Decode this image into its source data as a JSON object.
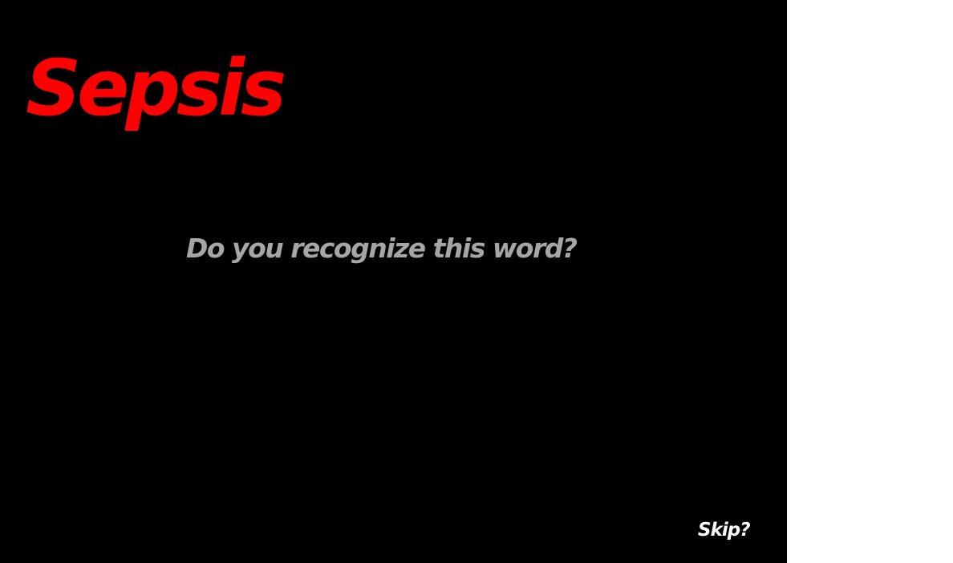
{
  "stimulus": {
    "word": "Sepsis",
    "word_color": "#ff0000"
  },
  "prompt": {
    "question": "Do you recognize this word?",
    "question_color": "#a6a6a6"
  },
  "controls": {
    "skip_label": "Skip?",
    "skip_color": "#ffffff"
  },
  "colors": {
    "stage_background": "#000000",
    "page_background": "#ffffff"
  }
}
